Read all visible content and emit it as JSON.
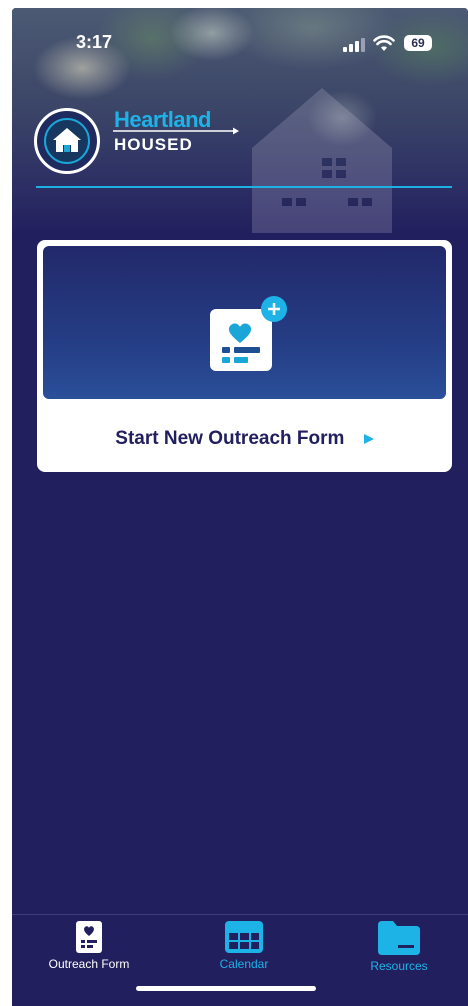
{
  "status_bar": {
    "time": "3:17",
    "battery": "69"
  },
  "brand": {
    "line1": "Heartland",
    "line2": "HOUSED"
  },
  "card": {
    "label": "Start New Outreach Form"
  },
  "tabs": [
    {
      "label": "Outreach Form",
      "icon": "form-icon",
      "active": true
    },
    {
      "label": "Calendar",
      "icon": "calendar-icon",
      "active": false
    },
    {
      "label": "Resources",
      "icon": "folder-icon",
      "active": false
    }
  ],
  "colors": {
    "background": "#221f5e",
    "accent": "#1eb3e6",
    "card": "#ffffff"
  }
}
